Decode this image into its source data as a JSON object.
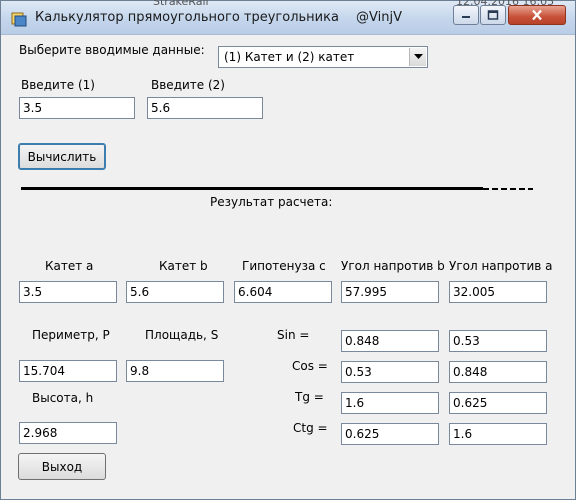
{
  "window": {
    "title": "Калькулятор прямоугольного треугольника",
    "author_tag": "@VinjV",
    "background_items": [
      "StrakeRall",
      "12.04.2016 16:05"
    ]
  },
  "input": {
    "mode_label": "Выберите вводимые данные:",
    "mode_selected": "(1) Катет и (2) катет",
    "field1_label": "Введите (1)",
    "field1_value": "3.5",
    "field2_label": "Введите (2)",
    "field2_value": "5.6",
    "calculate_label": "Вычислить"
  },
  "results": {
    "header": "Результат расчета:",
    "leg_a_label": "Катет a",
    "leg_a_value": "3.5",
    "leg_b_label": "Катет b",
    "leg_b_value": "5.6",
    "hypotenuse_label": "Гипотенуза c",
    "hypotenuse_value": "6.604",
    "angle_b_label": "Угол напротив b",
    "angle_b_value": "57.995",
    "angle_a_label": "Угол напротив a",
    "angle_a_value": "32.005",
    "perimeter_label": "Периметр, P",
    "perimeter_value": "15.704",
    "area_label": "Площадь, S",
    "area_value": "9.8",
    "height_label": "Высота, h",
    "height_value": "2.968",
    "sin_label": "Sin =",
    "sin_b_value": "0.848",
    "sin_a_value": "0.53",
    "cos_label": "Cos =",
    "cos_b_value": "0.53",
    "cos_a_value": "0.848",
    "tg_label": "Tg =",
    "tg_b_value": "1.6",
    "tg_a_value": "0.625",
    "ctg_label": "Ctg =",
    "ctg_b_value": "0.625",
    "ctg_a_value": "1.6"
  },
  "exit_label": "Выход",
  "colors": {
    "titlebar": "#c4d6ec",
    "close_button": "#c75238",
    "window_bg": "#f0f0f0"
  },
  "icons": [
    "app-icon",
    "minimize-icon",
    "maximize-icon",
    "close-icon",
    "dropdown-arrow-icon"
  ]
}
